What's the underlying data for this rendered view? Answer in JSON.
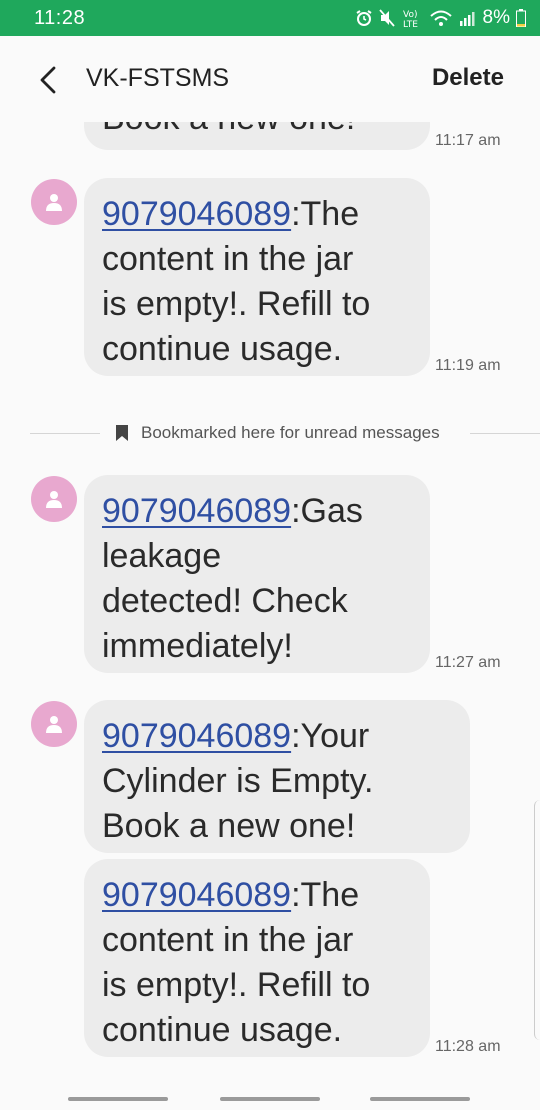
{
  "status_bar": {
    "time": "11:28",
    "lte_label": "Vo)\nLTE",
    "battery": "8%",
    "background_color": "#1fa85c"
  },
  "header": {
    "title": "VK-FSTSMS",
    "delete_label": "Delete",
    "back_icon": "chevron-left-icon"
  },
  "messages": [
    {
      "sender_number": "",
      "text": "Book a new one!",
      "time": "11:17 am",
      "partial": true
    },
    {
      "sender_number": "9079046089",
      "text": ":The content in the jar is empty!. Refill to continue usage.",
      "lines": [
        "9079046089:The",
        "content in the jar",
        "is empty!. Refill to",
        "continue usage."
      ],
      "time": "11:19 am"
    },
    {
      "sender_number": "9079046089",
      "text": ":Gas leakage detected! Check immediately!",
      "lines": [
        "9079046089:Gas",
        "leakage",
        "detected! Check",
        "immediately!"
      ],
      "time": "11:27 am"
    },
    {
      "sender_number": "9079046089",
      "text": ":Your Cylinder is Empty. Book a new one!",
      "lines": [
        "9079046089:Your",
        "Cylinder is Empty.",
        "Book a new one!"
      ],
      "time": ""
    },
    {
      "sender_number": "9079046089",
      "text": ":The content in the jar is empty!. Refill to continue usage.",
      "lines": [
        "9079046089:The",
        "content in the jar",
        "is empty!. Refill to",
        "continue usage."
      ],
      "time": "11:28 am"
    }
  ],
  "bookmark": {
    "text": "Bookmarked here for unread messages",
    "icon": "bookmark-icon"
  },
  "colors": {
    "bubble": "#ececec",
    "link": "#2f4fa3",
    "avatar": "#e8a8cf"
  }
}
